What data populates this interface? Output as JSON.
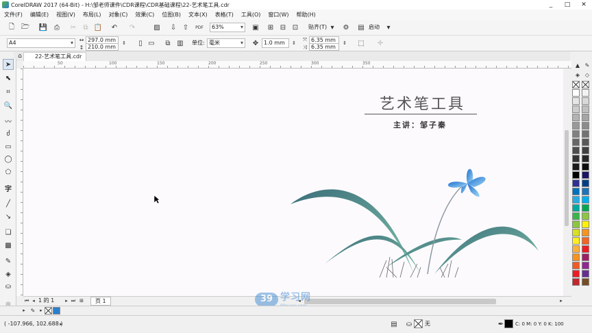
{
  "window": {
    "title": "CorelDRAW 2017 (64-Bit) - H:\\邹老师课件\\CDR课程\\CDR基础课程\\22-艺术笔工具.cdr",
    "controls": [
      "_",
      "□",
      "✕"
    ]
  },
  "menu": [
    "文件(F)",
    "编辑(E)",
    "视图(V)",
    "布局(L)",
    "对象(C)",
    "效果(C)",
    "位图(B)",
    "文本(X)",
    "表格(T)",
    "工具(O)",
    "窗口(W)",
    "帮助(H)"
  ],
  "toolbar1": {
    "zoom": "63%",
    "snap_label": "贴齐(T)",
    "launch_label": "启动"
  },
  "toolbar2": {
    "page_size": "A4",
    "width": "297.0 mm",
    "height": "210.0 mm",
    "units_label": "单位:",
    "units": "毫米",
    "nudge": "1.0 mm",
    "dup_x": "6.35 mm",
    "dup_y": "6.35 mm"
  },
  "document_tab": "22-艺术笔工具.cdr",
  "ruler": {
    "marks": [
      "50",
      "100",
      "150",
      "200",
      "250",
      "300",
      "350"
    ]
  },
  "canvas": {
    "title": "艺术笔工具",
    "subtitle": "主讲：邹子秦"
  },
  "pagebar": {
    "page_of": "1 的 1",
    "page_tab": "页 1"
  },
  "watermark": {
    "main": "学习网",
    "sub": "99xuexi.com",
    "badge": "39"
  },
  "status": {
    "coords": "( -107.966, 102.688 )",
    "fill_none": "无",
    "color_info": "C: 0 M: 0 Y: 0 K: 100"
  },
  "colors": {
    "accent": "#2a7fd0",
    "leaf": "#4f8f8a",
    "flower": "#2f7fd8"
  },
  "palette": [
    "#ffffff",
    "#e6e6e6",
    "#cccccc",
    "#b3b3b3",
    "#999999",
    "#808080",
    "#666666",
    "#4d4d4d",
    "#333333",
    "#1a1a1a",
    "#000000",
    "#2e3192",
    "#0071bc",
    "#29abe2",
    "#00a99d",
    "#39b54a",
    "#8cc63f",
    "#d9e021",
    "#fcee21",
    "#fbb03b",
    "#f7931e",
    "#f15a24",
    "#ed1c24",
    "#c1272d",
    "#9e005d",
    "#662d91",
    "#8b5e3c",
    "#c69c6d"
  ],
  "palette2": [
    "#f2f2f2",
    "#d9d9d9",
    "#bfbfbf",
    "#a6a6a6",
    "#8c8c8c",
    "#737373",
    "#595959",
    "#404040",
    "#262626",
    "#0d0d0d",
    "#1b1464",
    "#003f88",
    "#1b75bb",
    "#00aeef",
    "#00a651",
    "#8dc63f",
    "#fff200",
    "#f7941d",
    "#f26522",
    "#ed1c24",
    "#9e1f63",
    "#92278f",
    "#662d91",
    "#754c24",
    "#a67c52",
    "#c7b299",
    "#e6d5b8",
    "#534741"
  ]
}
